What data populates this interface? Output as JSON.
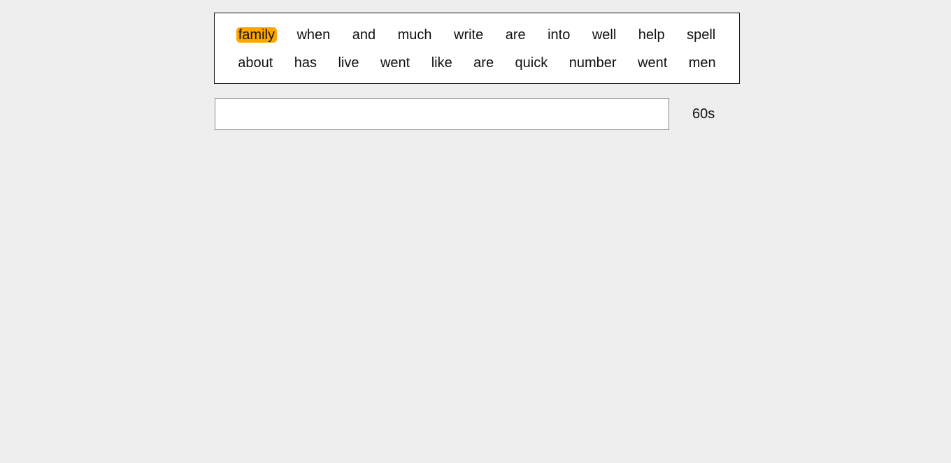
{
  "words": {
    "row1": [
      "family",
      "when",
      "and",
      "much",
      "write",
      "are",
      "into",
      "well",
      "help",
      "spell"
    ],
    "row2": [
      "about",
      "has",
      "live",
      "went",
      "like",
      "are",
      "quick",
      "number",
      "went",
      "men"
    ],
    "current_index": 0,
    "highlight_color": "#ffa500"
  },
  "input": {
    "value": "",
    "placeholder": ""
  },
  "timer": {
    "label": "60s"
  }
}
